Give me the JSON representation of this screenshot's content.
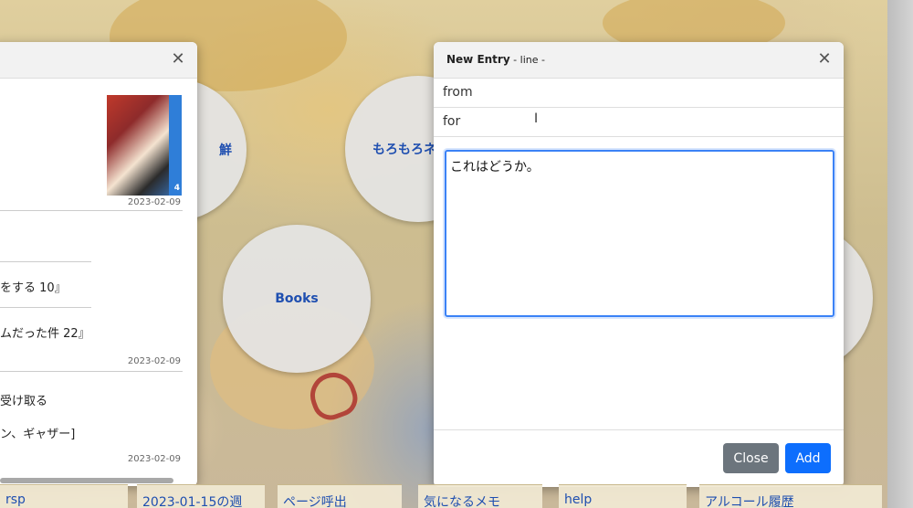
{
  "circles": [
    {
      "label": "鮮"
    },
    {
      "label": "もろもろネ"
    },
    {
      "label": "Books"
    },
    {
      "label": ""
    }
  ],
  "left_modal": {
    "entries": [
      {
        "date": "2023-02-09"
      },
      {
        "line1": "をする 10』",
        "line2": "ムだった件 22』",
        "date": "2023-02-09"
      },
      {
        "line1": "受け取る",
        "line2": "ン、ギャザー]",
        "date": "2023-02-09"
      }
    ],
    "book_cover_number": "4"
  },
  "right_modal": {
    "title": "New Entry",
    "subtitle": " - line -",
    "from_placeholder": "from",
    "for_placeholder": "for",
    "text_value": "これはどうか。",
    "close_label": "Close",
    "add_label": "Add"
  },
  "bottom_tabs": [
    {
      "label": "rsp"
    },
    {
      "label": "2023-01-15の週"
    },
    {
      "label": "ページ呼出"
    },
    {
      "label": "気になるメモ"
    },
    {
      "label": "help"
    },
    {
      "label": "アルコール履歴"
    }
  ]
}
